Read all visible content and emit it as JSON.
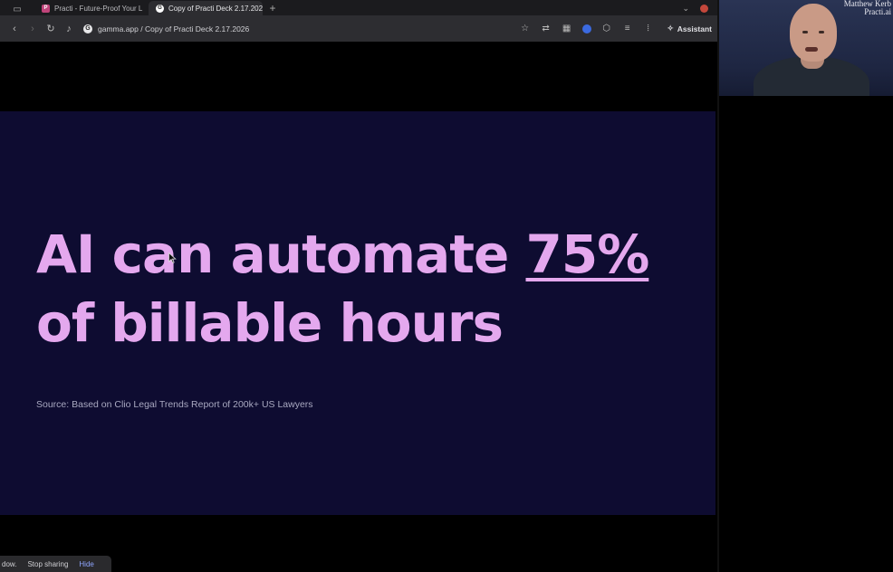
{
  "browser": {
    "tabs": [
      {
        "label": "Practi - Future-Proof Your L",
        "icon": "practi-favicon",
        "active": false
      },
      {
        "label": "Copy of Practi Deck 2.17.202",
        "icon": "gamma-favicon",
        "active": true
      }
    ],
    "new_tab_label": "+",
    "address": "gamma.app / Copy of Practi Deck 2.17.2026",
    "assistant_label": "Assistant"
  },
  "slide": {
    "headline_line1_prefix": "AI can automate ",
    "headline_highlight": "75%",
    "headline_line2": "of billable hours",
    "source": "Source: Based on Clio Legal Trends Report of 200k+ US Lawyers",
    "background_color": "#0e0c31",
    "text_color": "#e4a8ee"
  },
  "share_bar": {
    "prefix": "dow.",
    "stop_label": "Stop sharing",
    "hide_label": "Hide"
  },
  "webcam": {
    "name_line1": "Matthew Kerb",
    "name_line2": "Practi.ai"
  }
}
